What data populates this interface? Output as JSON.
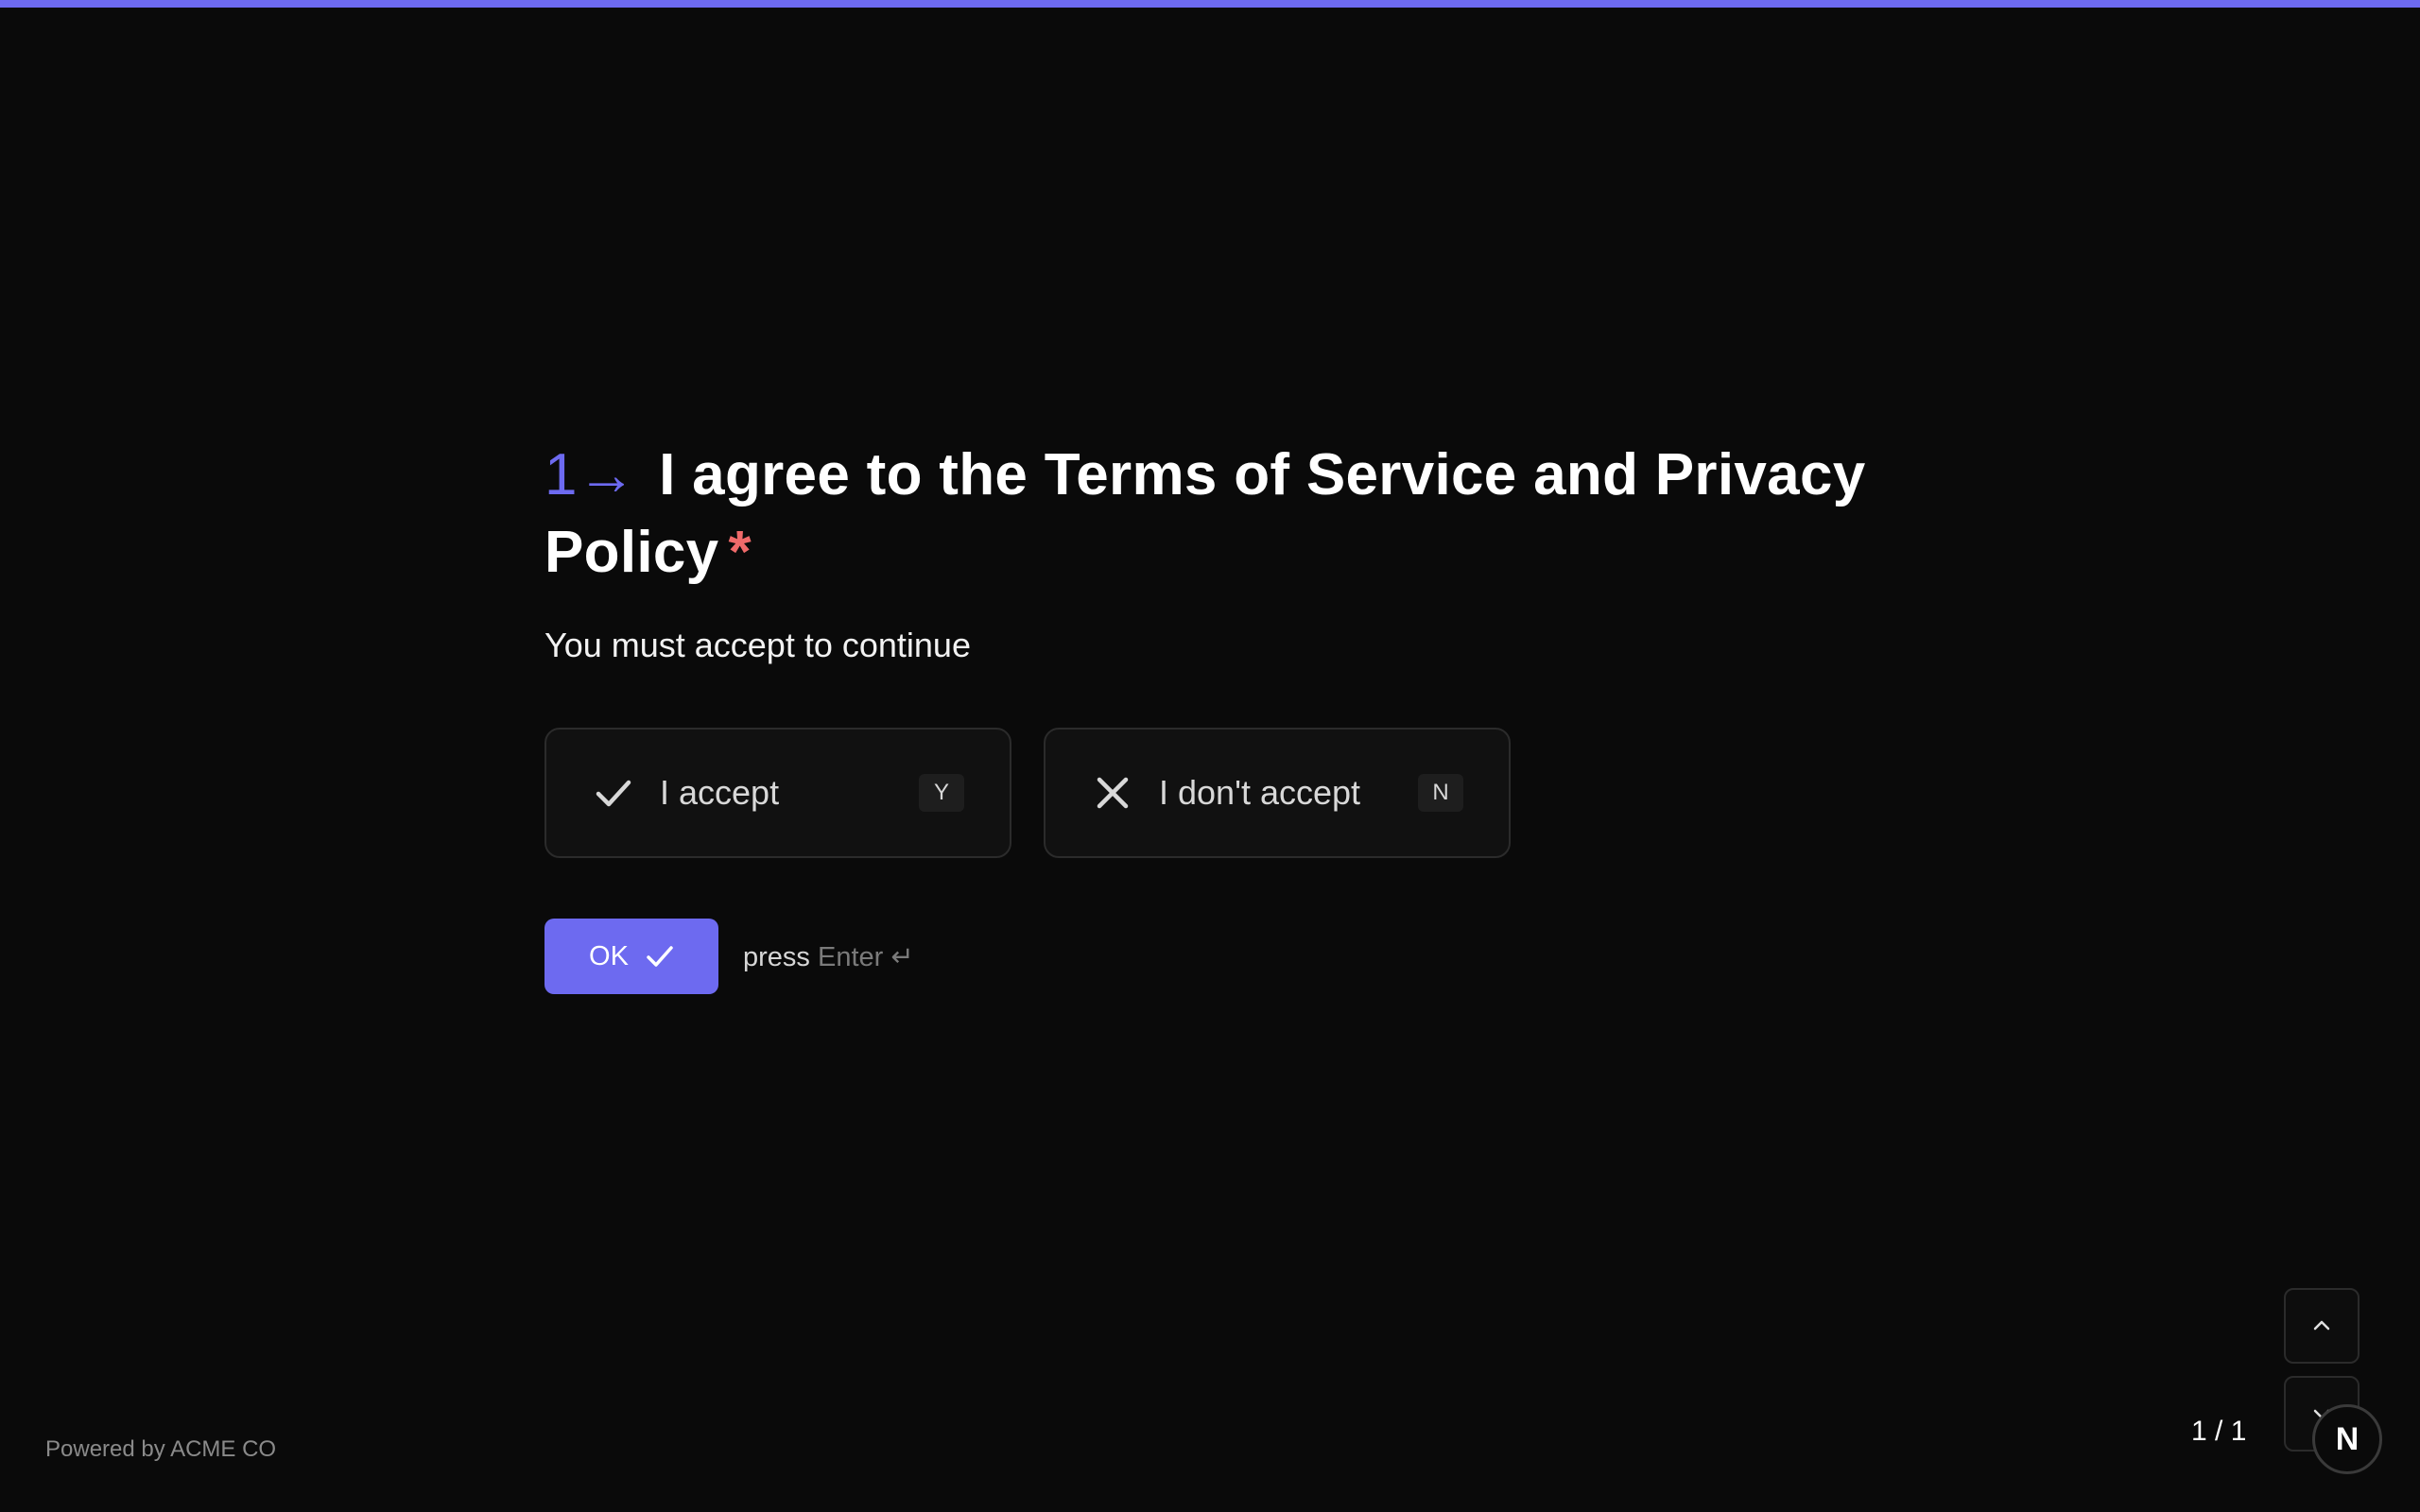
{
  "colors": {
    "accent": "#6d6af0",
    "background": "#0a0a0a",
    "required": "#f06a6a"
  },
  "question": {
    "number": "1",
    "arrow": "→",
    "title": "I agree to the Terms of Service and Privacy Policy",
    "required_mark": "*",
    "description": "You must accept to continue"
  },
  "choices": [
    {
      "icon": "check-icon",
      "label": "I accept",
      "key": "Y"
    },
    {
      "icon": "x-icon",
      "label": "I don't accept",
      "key": "N"
    }
  ],
  "submit": {
    "label": "OK",
    "icon": "check-icon",
    "hint_prefix": "press",
    "hint_key": "Enter ↵"
  },
  "footer": {
    "brand": "Powered by ACME CO",
    "page_counter": "1 / 1",
    "nav_up_icon": "chevron-up-icon",
    "nav_down_icon": "chevron-down-icon",
    "badge": "N"
  },
  "progress": 1
}
